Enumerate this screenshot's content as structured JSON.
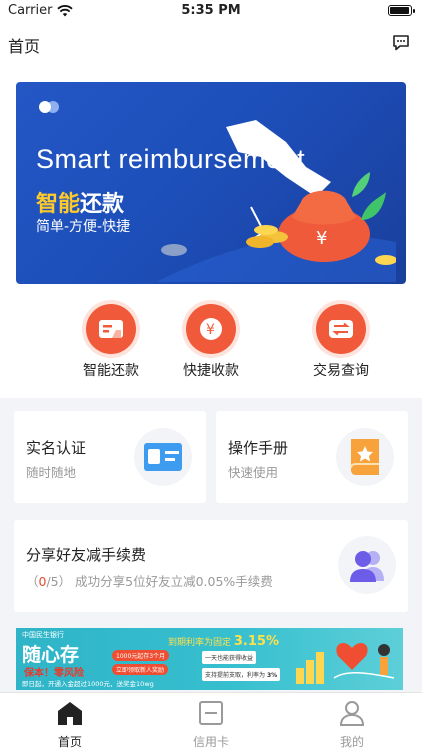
{
  "status_bar": {
    "carrier": "Carrier",
    "time": "5:35 PM"
  },
  "nav": {
    "title": "首页",
    "message_icon": "message-icon"
  },
  "banner": {
    "headline_en": "Smart reimbursement",
    "headline_cn_highlight": "智能",
    "headline_cn_rest": "还款",
    "subtitle": "简单-方便-快捷",
    "accent_color": "#ffcb2a"
  },
  "quick_actions": [
    {
      "label": "智能还款",
      "icon": "card-icon"
    },
    {
      "label": "快捷收款",
      "icon": "yen-icon"
    },
    {
      "label": "交易查询",
      "icon": "exchange-icon"
    }
  ],
  "cards": {
    "verify": {
      "title": "实名认证",
      "subtitle": "随时随地",
      "icon": "id-card-icon"
    },
    "manual": {
      "title": "操作手册",
      "subtitle": "快速使用",
      "icon": "book-star-icon"
    },
    "share": {
      "title": "分享好友减手续费",
      "count_open": "（",
      "count_current": "0",
      "count_rest": "/5）",
      "description": "成功分享5位好友立减0.05%手续费",
      "icon": "users-icon"
    }
  },
  "ad": {
    "bank_name": "中国民生银行",
    "headline": "随心存",
    "slogan": "保本！零风险",
    "footer": "即日起，开通入金超过1000元，送奖金10wg",
    "rate_label": "到期利率为固定",
    "rate_value": "3.15%",
    "rate2_label": "支持提前支取，利率为",
    "rate2_value": "3%",
    "pill_1": "1000元起存3个月",
    "pill_2": "立即领取新人奖励",
    "box_1": "一天也能获得收益"
  },
  "tabs": [
    {
      "label": "首页",
      "icon": "home-icon",
      "active": true
    },
    {
      "label": "信用卡",
      "icon": "credit-card-icon",
      "active": false
    },
    {
      "label": "我的",
      "icon": "profile-icon",
      "active": false
    }
  ],
  "colors": {
    "primary_red": "#f05a3a",
    "banner_blue": "#1d4fba",
    "tab_active": "#222222",
    "tab_inactive": "#9a9a9a"
  }
}
